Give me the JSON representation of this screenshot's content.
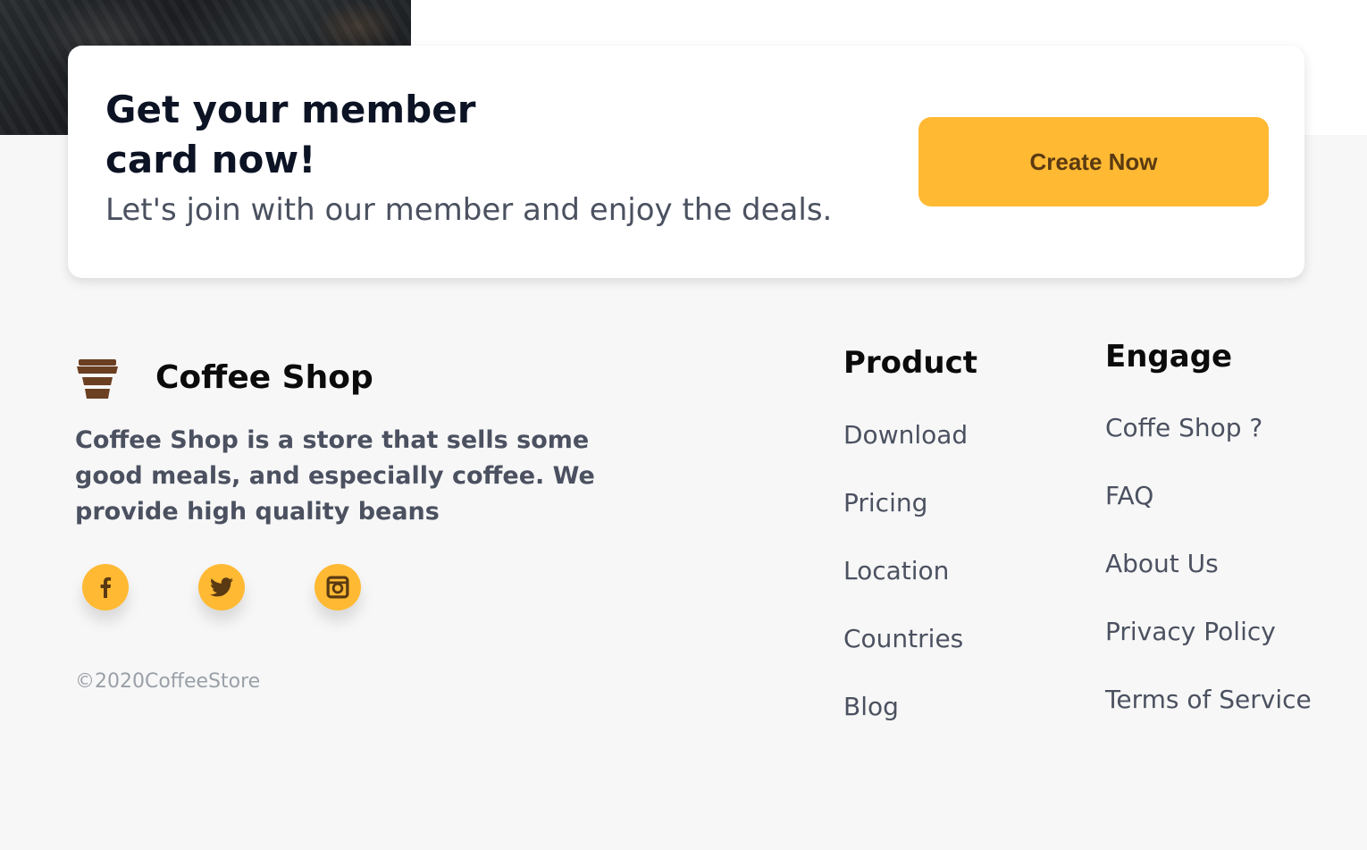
{
  "member_card": {
    "title": "Get your member card now!",
    "subtitle": "Let's join with our member and enjoy the deals.",
    "button_label": "Create Now"
  },
  "footer": {
    "brand_name": "Coffee Shop",
    "brand_icon": "coffee-cup-icon",
    "description": "Coffee Shop is a store that sells some good meals, and especially coffee. We provide high quality beans",
    "social": [
      {
        "name": "facebook",
        "icon": "facebook-icon"
      },
      {
        "name": "twitter",
        "icon": "twitter-icon"
      },
      {
        "name": "instagram",
        "icon": "instagram-icon"
      }
    ],
    "copyright": "©2020CoffeeStore",
    "product": {
      "heading": "Product",
      "links": [
        "Download",
        "Pricing",
        "Location",
        "Countries",
        "Blog"
      ]
    },
    "engage": {
      "heading": "Engage",
      "links": [
        "Coffe Shop ?",
        "FAQ",
        "About Us",
        "Privacy Policy",
        "Terms of Service"
      ]
    }
  },
  "colors": {
    "accent": "#ffb933",
    "button_text": "#5a3a12",
    "brand_icon": "#6b3f22",
    "heading": "#0b1324",
    "body_text": "#4b5160",
    "muted_text": "#9aa0a8",
    "footer_background": "#f7f7f7"
  }
}
